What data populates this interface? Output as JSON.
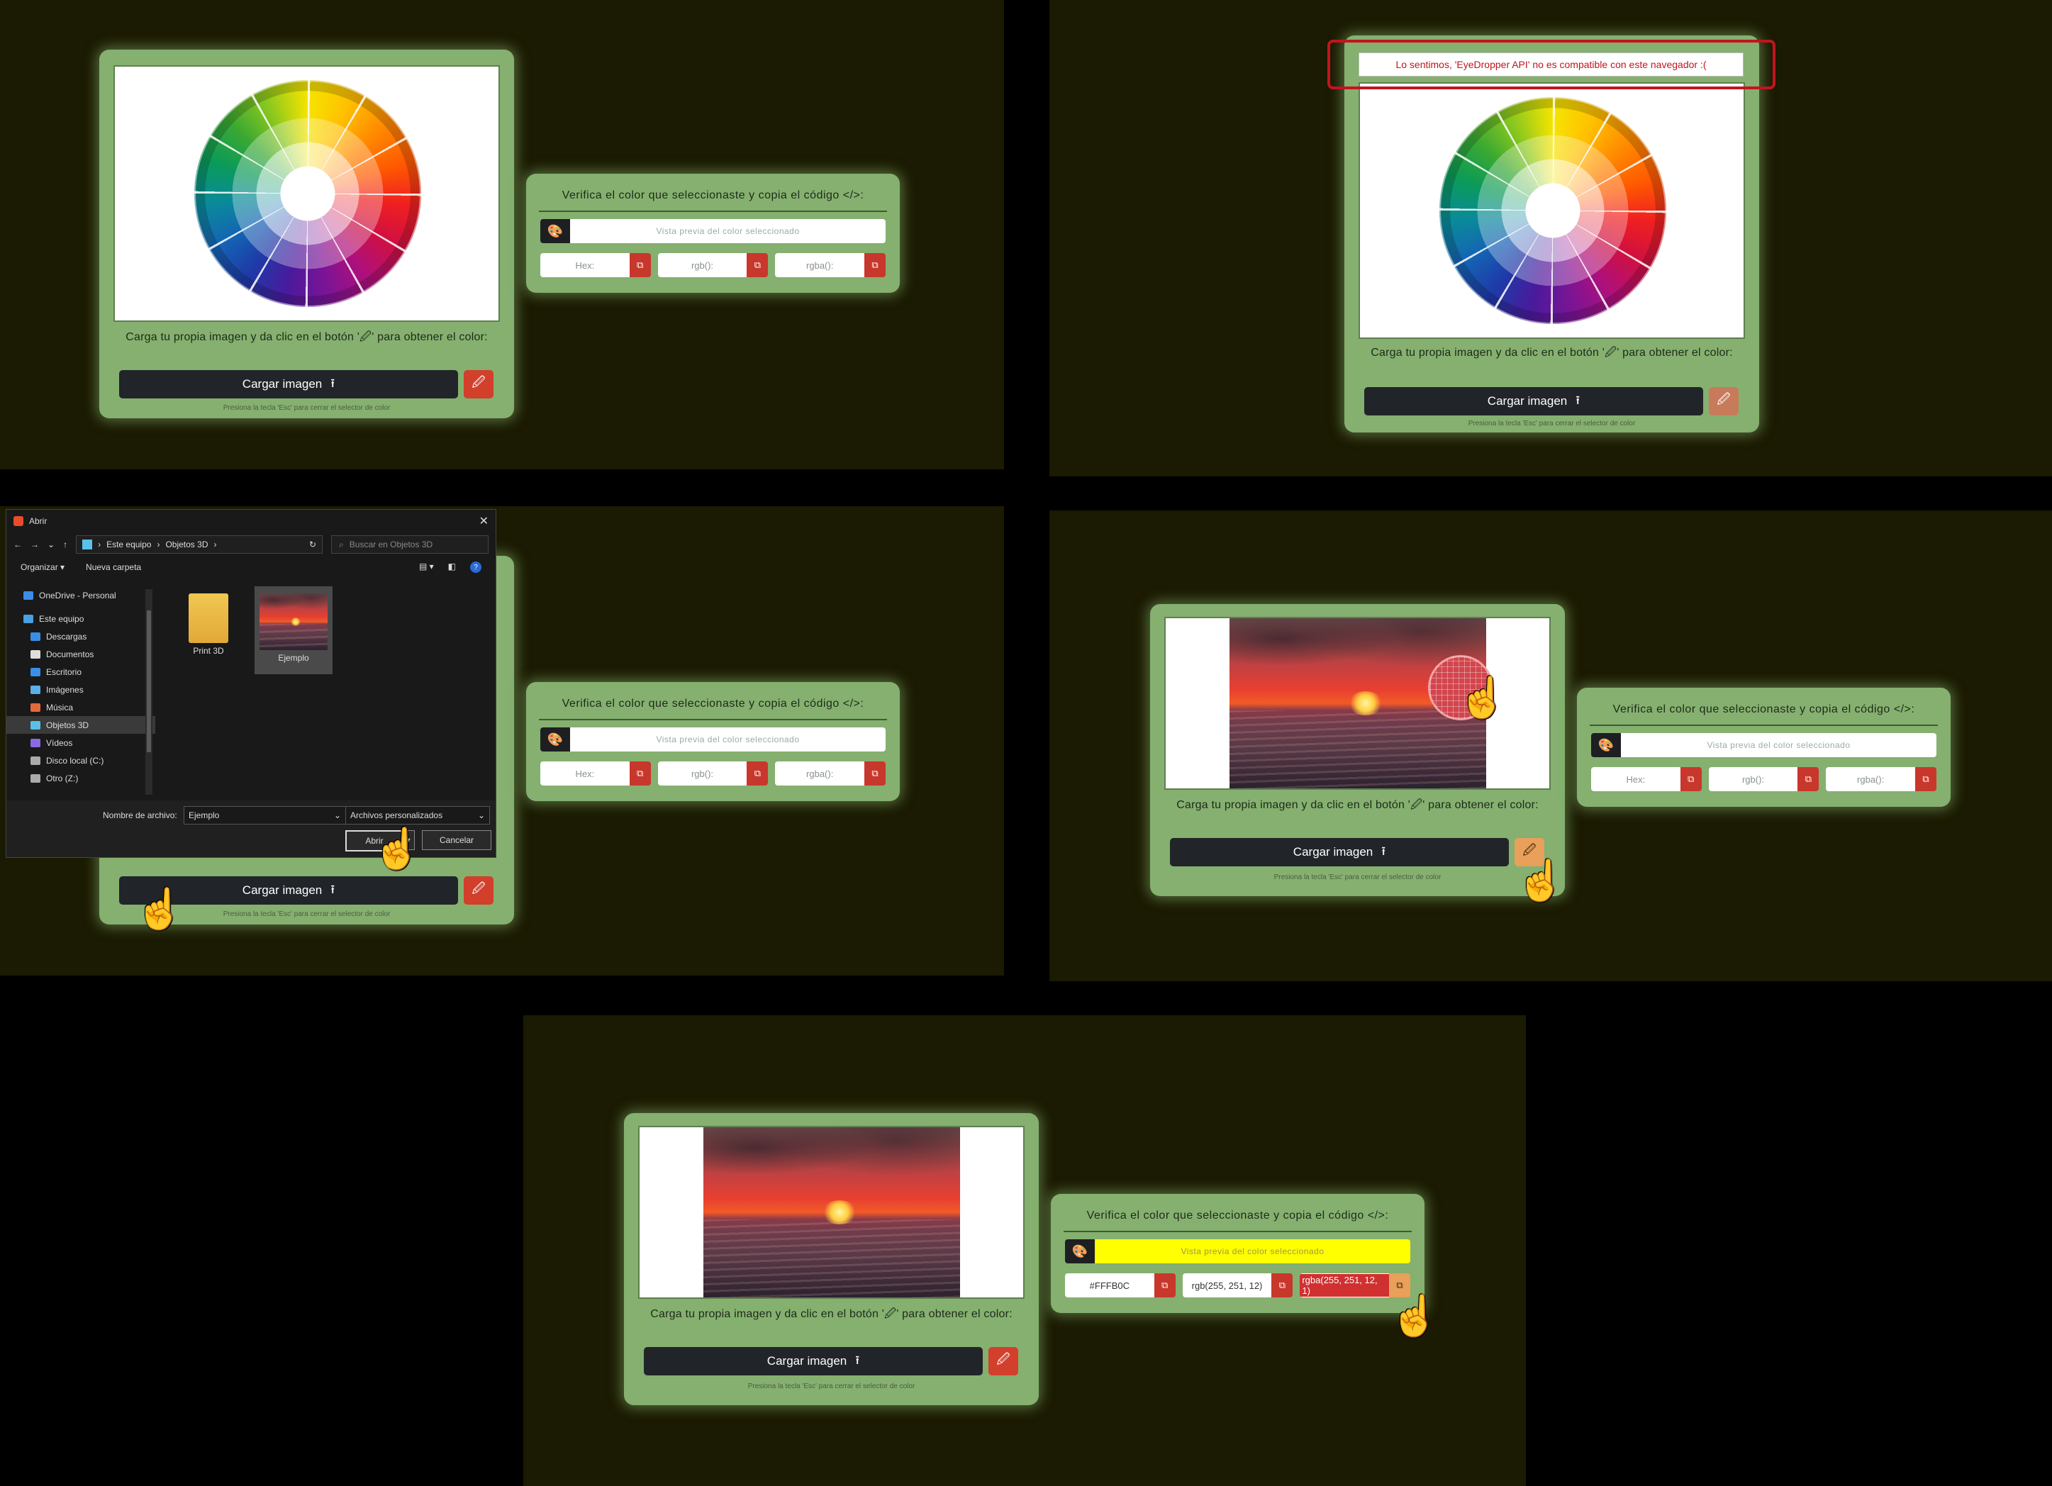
{
  "app": {
    "card_caption": "Carga tu propia imagen y da clic en el botón '🖉' para obtener el color:",
    "load_button": "Cargar imagen",
    "upload_glyph": "⭱",
    "picker_glyph": "🖉",
    "hint": "Presiona la tecla 'Esc' para cerrar el selector de color",
    "verify_title": "Verifica el color que seleccionaste y copia el código </>:",
    "preview_placeholder": "Vista previa del color seleccionado",
    "palette_glyph": "🎨",
    "copy_glyph": "⧉",
    "hex_placeholder": "Hex:",
    "rgb_placeholder": "rgb():",
    "rgba_placeholder": "rgba():",
    "error_message": "Lo sentimos, 'EyeDropper API' no es compatible con este navegador :(",
    "cursor_glyph": "☝"
  },
  "result": {
    "hex": "#FFFB0C",
    "rgb": "rgb(255, 251, 12)",
    "rgba": "rgba(255, 251, 12, 1)",
    "preview_color": "#ffff00"
  },
  "dialog": {
    "title": "Abrir",
    "close": "✕",
    "nav_back": "←",
    "nav_forward": "→",
    "nav_recent": "⌄",
    "nav_up": "↑",
    "breadcrumb": [
      "Este equipo",
      "Objetos 3D"
    ],
    "refresh": "↻",
    "search_placeholder": "Buscar en Objetos 3D",
    "organize": "Organizar ▾",
    "new_folder": "Nueva carpeta",
    "help": "?",
    "nav_items": [
      {
        "label": "OneDrive - Personal",
        "color": "#3a8ee6"
      },
      {
        "label": "Este equipo",
        "color": "#4aa0e0"
      },
      {
        "label": "Descargas",
        "color": "#3a8ee6"
      },
      {
        "label": "Documentos",
        "color": "#dddddd"
      },
      {
        "label": "Escritorio",
        "color": "#3a8ee6"
      },
      {
        "label": "Imágenes",
        "color": "#5ab0e8"
      },
      {
        "label": "Música",
        "color": "#e26a3a"
      },
      {
        "label": "Objetos 3D",
        "color": "#5ac0e8"
      },
      {
        "label": "Vídeos",
        "color": "#8a6ae0"
      },
      {
        "label": "Disco local (C:)",
        "color": "#aaaaaa"
      },
      {
        "label": "Otro (Z:)",
        "color": "#aaaaaa"
      }
    ],
    "files": [
      {
        "name": "Print 3D",
        "kind": "folder"
      },
      {
        "name": "Ejemplo",
        "kind": "image"
      }
    ],
    "filename_label": "Nombre de archivo:",
    "filename_value": "Ejemplo",
    "filetype_value": "Archivos personalizados",
    "open_button": "Abrir",
    "cancel_button": "Cancelar"
  },
  "colors": {
    "card": "#85b06f",
    "panel_bg": "#1b1a02",
    "load_button": "#212529",
    "picker_button": "#d23f2b",
    "picker_active": "#e8a05a",
    "error": "#c21420"
  }
}
